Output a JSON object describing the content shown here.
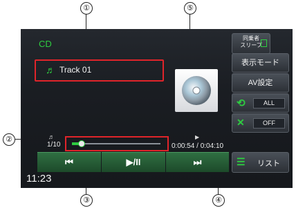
{
  "callouts": [
    "①",
    "②",
    "③",
    "④",
    "⑤"
  ],
  "screen": {
    "source_label": "CD",
    "track_title": "Track 01",
    "track_icon": "music-note-icon",
    "track_counter": "1/10",
    "elapsed_total": "0:00:54 / 0:04:10",
    "progress_fraction": 0.1,
    "clock": "11:23",
    "cover_icon": "disc-icon",
    "sleep_button": {
      "line1": "同乗者",
      "line2": "スリープ"
    },
    "display_mode": "表示モード",
    "av_settings": "AV設定",
    "repeat": {
      "icon": "repeat-icon",
      "value": "ALL"
    },
    "shuffle": {
      "icon": "shuffle-icon",
      "value": "OFF"
    },
    "controls": {
      "prev": "⏮",
      "play_pause": "▶/II",
      "next": "⏭"
    },
    "list_button": {
      "icon": "list-icon",
      "label": "リスト"
    }
  },
  "colors": {
    "accent_green": "#2ecc40",
    "highlight_red": "#e0242a"
  }
}
